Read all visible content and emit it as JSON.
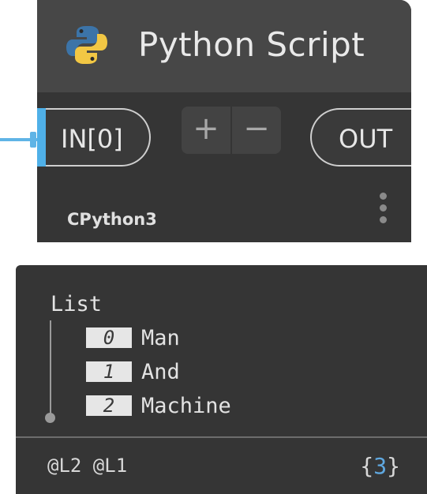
{
  "node": {
    "title": "Python Script",
    "icon": "python-logo-icon",
    "input_port": {
      "label": "IN[0]"
    },
    "add_input_label": "+",
    "remove_input_label": "−",
    "output_port": {
      "label": "OUT"
    },
    "engine": "CPython3",
    "menu_icon": "vertical-dots-icon"
  },
  "preview": {
    "list_label": "List",
    "items": [
      {
        "index": "0",
        "value": "Man"
      },
      {
        "index": "1",
        "value": "And"
      },
      {
        "index": "2",
        "value": "Machine"
      }
    ],
    "levels": "@L2 @L1",
    "count_open": "{",
    "count": "3",
    "count_close": "}"
  },
  "colors": {
    "node_body": "#353535",
    "node_header": "#474747",
    "wire": "#5fb4e6",
    "python_blue": "#3c74a8",
    "python_yellow": "#f2c744",
    "count_accent": "#5fa8e0"
  }
}
